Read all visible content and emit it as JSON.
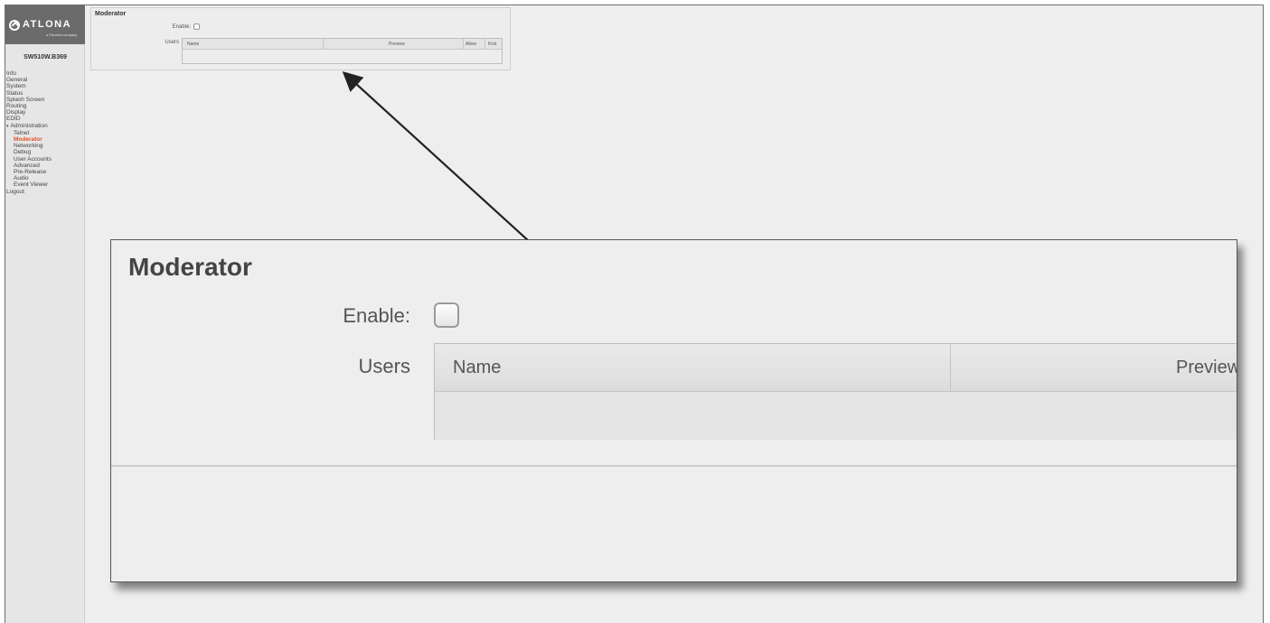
{
  "brand": {
    "logo_text": "ATLONA",
    "logo_sub": "a Panduit company"
  },
  "device": {
    "name": "SW510W.B369"
  },
  "nav": [
    {
      "label": "Info",
      "level": 0
    },
    {
      "label": "General",
      "level": 0
    },
    {
      "label": "System",
      "level": 0
    },
    {
      "label": "Status",
      "level": 0
    },
    {
      "label": "Splash Screen",
      "level": 0
    },
    {
      "label": "Routing",
      "level": 0
    },
    {
      "label": "Display",
      "level": 0
    },
    {
      "label": "EDID",
      "level": 0
    },
    {
      "label": "Administration",
      "level": 0,
      "expanded": true
    },
    {
      "label": "Telnet",
      "level": 1
    },
    {
      "label": "Moderator",
      "level": 1,
      "active": true
    },
    {
      "label": "Networking",
      "level": 1
    },
    {
      "label": "Debug",
      "level": 1
    },
    {
      "label": "User Accounts",
      "level": 1
    },
    {
      "label": "Advanced",
      "level": 1
    },
    {
      "label": "Pre-Release",
      "level": 1
    },
    {
      "label": "Audio",
      "level": 1
    },
    {
      "label": "Event Viewer",
      "level": 1
    },
    {
      "label": "Logout",
      "level": 0
    }
  ],
  "moderator": {
    "title": "Moderator",
    "enable_label": "Enable:",
    "enable_checked": false,
    "users_label": "Users",
    "columns": {
      "name": "Name",
      "preview": "Preview",
      "allow": "Allow",
      "kick": "Kick"
    }
  },
  "colors": {
    "active_nav": "#e8501f",
    "logo_bg": "#6b6b6b",
    "panel_bg": "#eeeeee"
  }
}
